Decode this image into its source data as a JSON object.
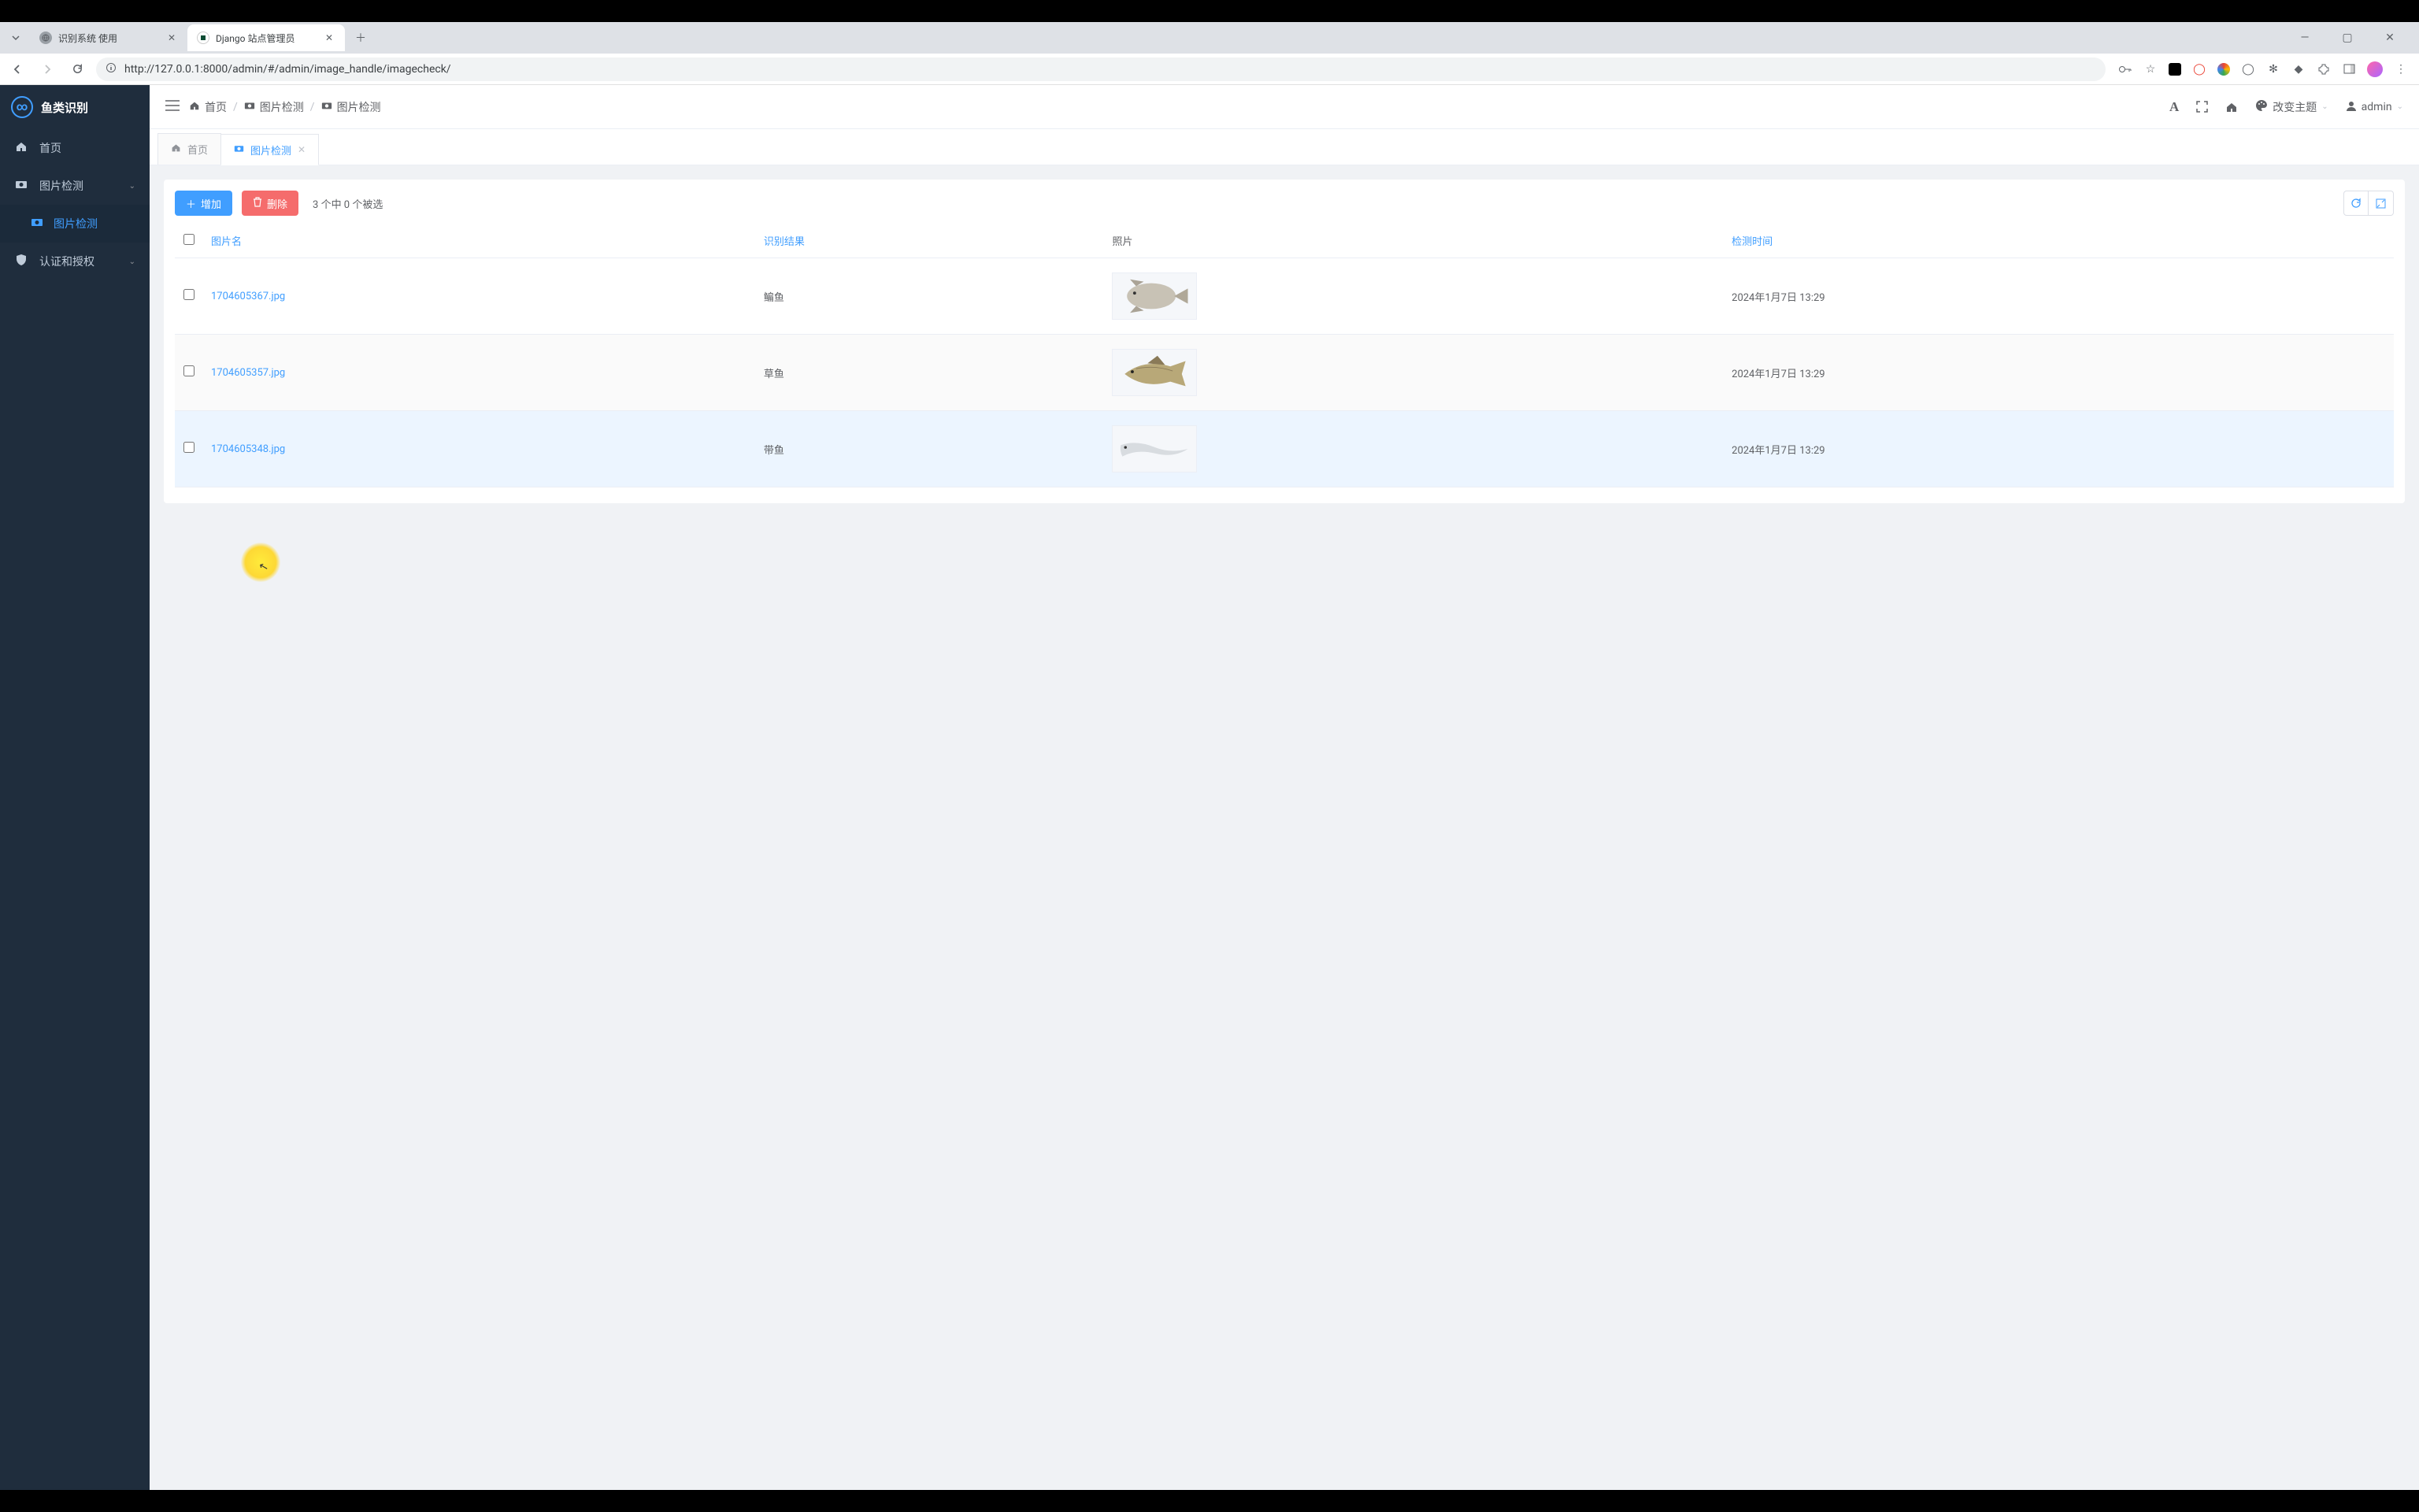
{
  "browser": {
    "tabs": [
      {
        "title": "识别系统 使用"
      },
      {
        "title": "Django 站点管理员"
      }
    ],
    "url": "http://127.0.0.1:8000/admin/#/admin/image_handle/imagecheck/"
  },
  "sidebar": {
    "brand": "鱼类识别",
    "items": [
      {
        "label": "首页",
        "icon": "home"
      },
      {
        "label": "图片检测",
        "icon": "camera",
        "expandable": true
      },
      {
        "label": "图片检测",
        "icon": "camera",
        "sub": true
      },
      {
        "label": "认证和授权",
        "icon": "shield",
        "expandable": true
      }
    ]
  },
  "topbar": {
    "breadcrumb": [
      {
        "label": "首页",
        "icon": "home"
      },
      {
        "label": "图片检测",
        "icon": "camera"
      },
      {
        "label": "图片检测",
        "icon": "camera"
      }
    ],
    "theme_label": "改变主题",
    "user": "admin"
  },
  "page_tabs": [
    {
      "label": "首页",
      "icon": "home"
    },
    {
      "label": "图片检测",
      "icon": "camera",
      "closable": true,
      "active": true
    }
  ],
  "toolbar": {
    "add_label": "增加",
    "delete_label": "删除",
    "selection_text": "3 个中 0 个被选"
  },
  "table": {
    "columns": {
      "name": "图片名",
      "result": "识别结果",
      "photo": "照片",
      "time": "检测时间"
    },
    "rows": [
      {
        "name": "1704605367.jpg",
        "result": "鳊鱼",
        "time": "2024年1月7日 13:29",
        "fish": "bream"
      },
      {
        "name": "1704605357.jpg",
        "result": "草鱼",
        "time": "2024年1月7日 13:29",
        "fish": "grasscarp"
      },
      {
        "name": "1704605348.jpg",
        "result": "带鱼",
        "time": "2024年1月7日 13:29",
        "fish": "hairtail"
      }
    ]
  }
}
